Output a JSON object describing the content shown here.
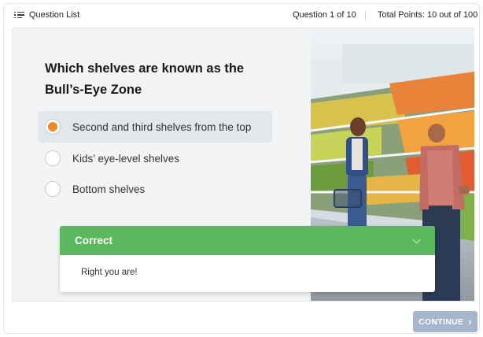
{
  "topbar": {
    "question_list_label": "Question List",
    "question_counter": "Question 1 of 10",
    "total_points": "Total Points: 10 out of 100"
  },
  "question": {
    "text": "Which shelves are known as the Bull’s-Eye Zone",
    "options": [
      {
        "label": "Second and third shelves from the top",
        "selected": true
      },
      {
        "label": "Kids’ eye-level shelves",
        "selected": false
      },
      {
        "label": "Bottom shelves",
        "selected": false
      }
    ]
  },
  "feedback": {
    "title": "Correct",
    "message": "Right you are!"
  },
  "footer": {
    "continue_label": "CONTINUE"
  },
  "colors": {
    "selected_radio": "#f08a24",
    "correct_header": "#5cb85c",
    "continue_button": "#a6b6cc"
  },
  "icons": {
    "question_list": "list-icon",
    "feedback_toggle": "chevron-down-icon",
    "continue": "chevron-right-icon"
  }
}
